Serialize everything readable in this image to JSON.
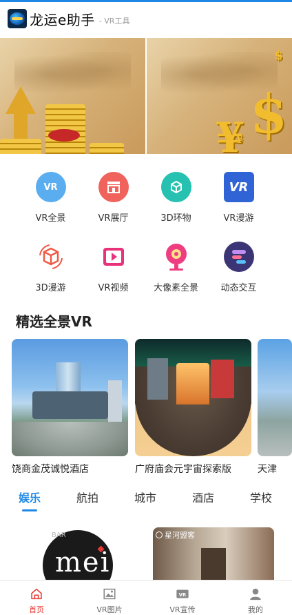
{
  "header": {
    "title": "龙运e助手",
    "subtitle": "- VR工具"
  },
  "icons": [
    {
      "label": "VR全景",
      "icon": "vr-panorama-icon",
      "color": "#5aaef0"
    },
    {
      "label": "VR展厅",
      "icon": "vr-showroom-icon",
      "color": "#f0635c"
    },
    {
      "label": "3D环物",
      "icon": "3d-object-icon",
      "color": "#26c1b0"
    },
    {
      "label": "VR漫游",
      "icon": "vr-tour-icon",
      "color": "#2f63d6"
    },
    {
      "label": "3D漫游",
      "icon": "3d-tour-icon",
      "color": "#ee5a45"
    },
    {
      "label": "VR视频",
      "icon": "vr-video-icon",
      "color": "#e8327a"
    },
    {
      "label": "大像素全景",
      "icon": "gigapixel-icon",
      "color": "#ef3d82"
    },
    {
      "label": "动态交互",
      "icon": "interactive-icon",
      "color": "#3b3576"
    }
  ],
  "featured": {
    "title": "精选全景VR",
    "cards": [
      {
        "caption": "饶商金茂诚悦酒店"
      },
      {
        "caption": "广府庙会元宇宙探索版"
      },
      {
        "caption": "天津"
      }
    ]
  },
  "tabs": [
    "娱乐",
    "航拍",
    "城市",
    "酒店",
    "学校"
  ],
  "active_tab": "娱乐",
  "feed": [
    {
      "badge": "BAR",
      "logo_text": "mei"
    },
    {
      "badge": "星河盟客"
    }
  ],
  "bottom_nav": [
    {
      "label": "首页",
      "icon": "home-icon",
      "active": true
    },
    {
      "label": "VR图片",
      "icon": "image-icon",
      "active": false
    },
    {
      "label": "VR宣传",
      "icon": "vr-promo-icon",
      "active": false
    },
    {
      "label": "我的",
      "icon": "user-icon",
      "active": false
    }
  ],
  "colors": {
    "accent": "#1e88e5",
    "nav_active": "#e53935"
  }
}
